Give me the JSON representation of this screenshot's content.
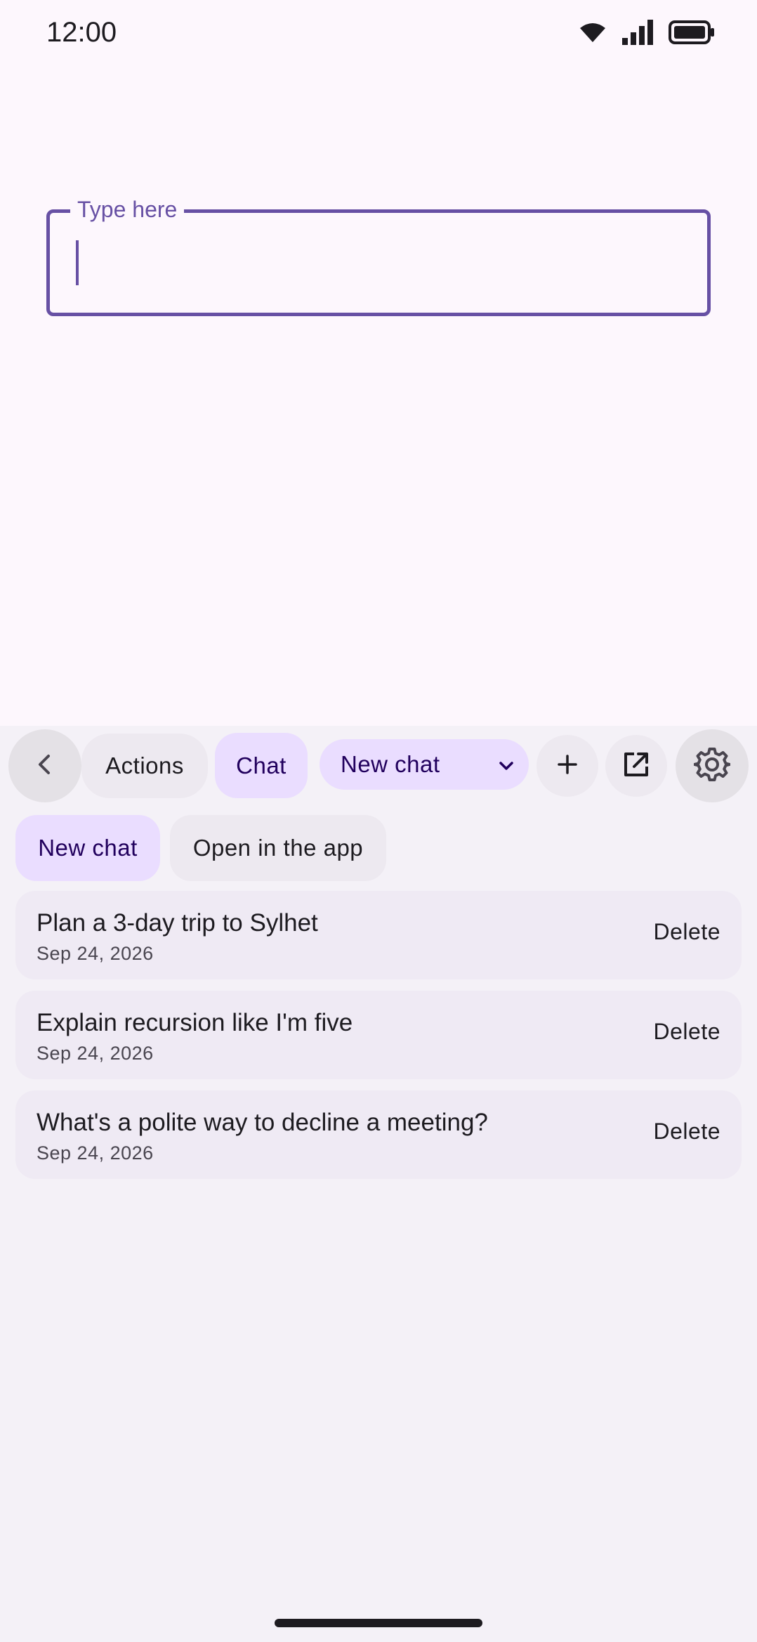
{
  "status_bar": {
    "time": "12:00",
    "icons": [
      "wifi-icon",
      "signal-icon",
      "battery-icon"
    ]
  },
  "input": {
    "label": "Type here",
    "value": ""
  },
  "toolbar": {
    "back_icon": "chevron-left-icon",
    "tabs": [
      {
        "label": "Actions",
        "selected": false
      },
      {
        "label": "Chat",
        "selected": true
      }
    ],
    "dropdown": {
      "selected": "New chat",
      "icon": "chevron-down-icon"
    },
    "add_icon": "plus-icon",
    "open_icon": "open-external-icon",
    "settings_icon": "gear-icon"
  },
  "chips": {
    "new_chat": "New chat",
    "open_in_app": "Open in the app"
  },
  "history": [
    {
      "title": "Plan a 3-day trip to Sylhet",
      "date": "Sep 24, 2026",
      "action": "Delete"
    },
    {
      "title": "Explain recursion like I'm five",
      "date": "Sep 24, 2026",
      "action": "Delete"
    },
    {
      "title": "What's a polite way to decline a meeting?",
      "date": "Sep 24, 2026",
      "action": "Delete"
    }
  ],
  "colors": {
    "background": "#fdf7fd",
    "panel": "#f4f1f7",
    "accent": "#6750a4",
    "selected_container": "#eaddff",
    "on_selected": "#21005d"
  }
}
